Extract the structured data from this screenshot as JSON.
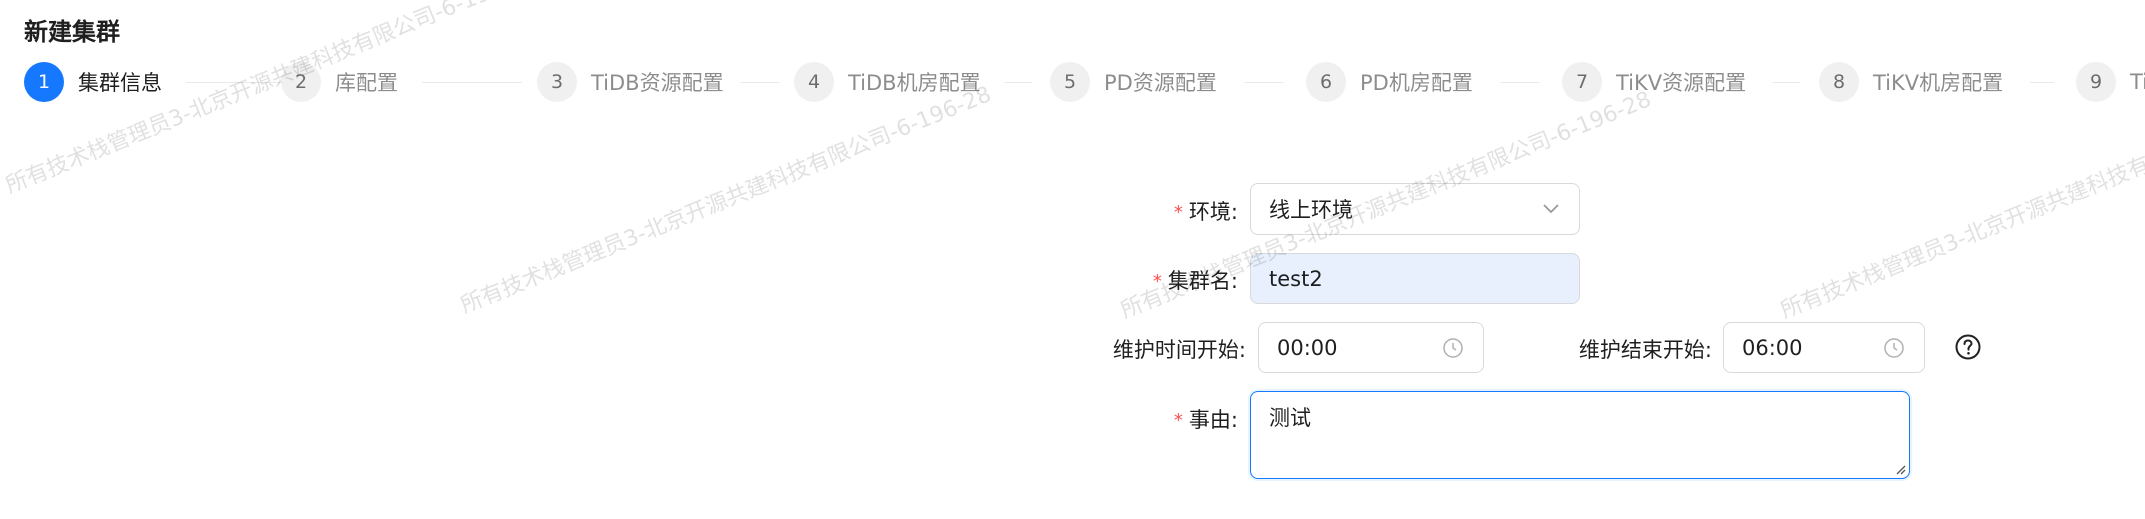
{
  "page": {
    "title": "新建集群"
  },
  "steps": [
    {
      "num": "1",
      "label": "集群信息",
      "active": true
    },
    {
      "num": "2",
      "label": "库配置"
    },
    {
      "num": "3",
      "label": "TiDB资源配置"
    },
    {
      "num": "4",
      "label": "TiDB机房配置"
    },
    {
      "num": "5",
      "label": "PD资源配置"
    },
    {
      "num": "6",
      "label": "PD机房配置"
    },
    {
      "num": "7",
      "label": "TiKV资源配置"
    },
    {
      "num": "8",
      "label": "TiKV机房配置"
    },
    {
      "num": "9",
      "label": "Ti"
    }
  ],
  "form": {
    "env_label": "环境:",
    "env_value": "线上环境",
    "name_label": "集群名:",
    "name_value": "test2",
    "maint_start_label": "维护时间开始:",
    "maint_start_value": "00:00",
    "maint_end_label": "维护结束开始:",
    "maint_end_value": "06:00",
    "reason_label": "事由:",
    "reason_value": "测试",
    "required_mark": "*"
  },
  "watermark": {
    "text": "所有技术栈管理员3-北京开源共建科技有限公司-6-196-28"
  },
  "colors": {
    "primary": "#1677ff",
    "required": "#ff4d4f",
    "autofill": "#e8f0fe"
  }
}
